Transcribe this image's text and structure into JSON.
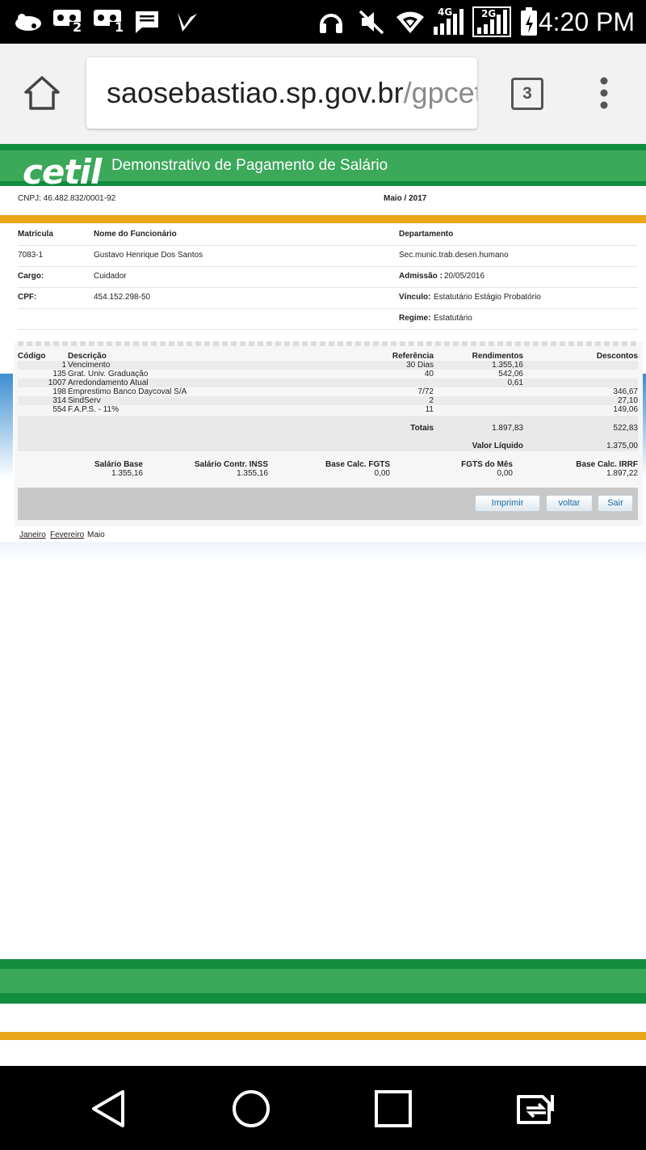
{
  "status_bar": {
    "time": "4:20 PM",
    "left_icons": [
      "weather-icon",
      "voicemail-2-icon",
      "voicemail-1-icon",
      "message-icon",
      "checkmark-app-icon"
    ],
    "right_icons": [
      "headset-icon",
      "mute-icon",
      "wifi-icon",
      "signal-4g-icon",
      "signal-2g-icon",
      "battery-icon"
    ],
    "net1": "4G",
    "net2": "2G",
    "badge1": "2",
    "badge2": "1"
  },
  "browser": {
    "url_host": "saosebastiao.sp.gov.br",
    "url_path": "/gpcetil",
    "tab_count": "3"
  },
  "header": {
    "logo": "cetil",
    "title": "Demonstrativo de Pagamento de Salário",
    "cnpj": "CNPJ: 46.482.832/0001-92",
    "period": "Maio / 2017"
  },
  "employee": {
    "matricula_label": "Matrícula",
    "nome_label": "Nome do Funcionário",
    "departamento_label": "Departamento",
    "matricula": "7083-1",
    "nome": "Gustavo Henrique Dos Santos",
    "departamento": "Sec.munic.trab.desen.humano",
    "cargo_label": "Cargo:",
    "cargo": "Cuidador",
    "admissao_label": "Admissão :",
    "admissao": "20/05/2016",
    "cpf_label": "CPF:",
    "cpf": "454.152.298-50",
    "vinculo_label": "Vínculo:",
    "vinculo": "Estatutário Estágio Probatório",
    "regime_label": "Regime:",
    "regime": "Estatutário"
  },
  "items": {
    "headers": [
      "Código",
      "Descrição",
      "Referência",
      "Rendimentos",
      "Descontos"
    ],
    "rows": [
      [
        "1",
        "Vencimento",
        "30 Dias",
        "1.355,16",
        ""
      ],
      [
        "135",
        "Grat. Univ. Graduação",
        "40",
        "542,06",
        ""
      ],
      [
        "1007",
        "Arredondamento Atual",
        "",
        "0,61",
        ""
      ],
      [
        "198",
        "Emprestimo Banco Daycoval S/A",
        "7/72",
        "",
        "346,67"
      ],
      [
        "314",
        "SindServ",
        "2",
        "",
        "27,10"
      ],
      [
        "554",
        "F.A.P.S. - 11%",
        "11",
        "",
        "149,06"
      ]
    ],
    "totais_label": "Totais",
    "totais_rendimentos": "1.897,83",
    "totais_descontos": "522,83",
    "liquido_label": "Valor Líquido",
    "liquido": "1.375,00"
  },
  "bases": {
    "salario_base_label": "Salário Base",
    "salario_base": "1.355,16",
    "contr_inss_label": "Salário Contr. INSS",
    "contr_inss": "1.355,16",
    "calc_fgts_label": "Base Calc. FGTS",
    "calc_fgts": "0,00",
    "fgts_mes_label": "FGTS do Mês",
    "fgts_mes": "0,00",
    "calc_irrf_label": "Base Calc. IRRF",
    "calc_irrf": "1.897,22"
  },
  "actions": {
    "imprimir": "Imprimir",
    "voltar": "voltar",
    "sair": "Sair"
  },
  "months": {
    "jan": "Janeiro",
    "feb": "Fevereiro",
    "current": "Maio"
  }
}
